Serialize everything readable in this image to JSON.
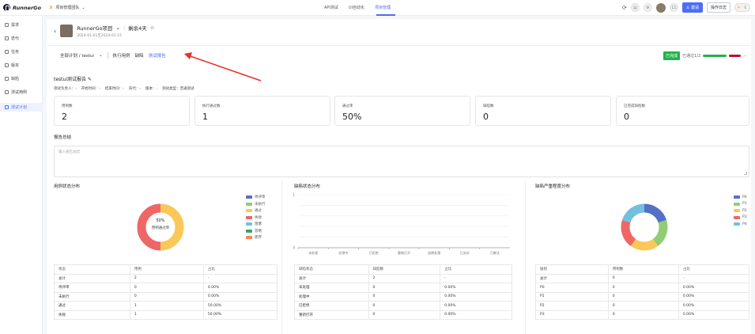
{
  "app": {
    "logo": "RunnerGo",
    "team": "项目管理团队"
  },
  "nav": {
    "items": [
      "API测试",
      "UI自动化",
      "项目管理"
    ],
    "active": 2
  },
  "topright": {
    "avatar_initial": "11",
    "invite": "邀请",
    "log": "操作日志"
  },
  "sidebar": {
    "items": [
      "需求",
      "迭代",
      "任务",
      "版本",
      "缺陷",
      "测试用例",
      "测试计划"
    ],
    "active": 6
  },
  "header": {
    "project": "RunnerGo项目",
    "remaining": "剩余4天",
    "date_range": "2024-01-01至2024-01-15"
  },
  "tabs": {
    "plan": "全部计划 / testui",
    "items": [
      "执行用例",
      "缺陷",
      "测试报告"
    ],
    "active": 2
  },
  "status": {
    "done": "已完成",
    "passed": "已通过1/2",
    "more": "···"
  },
  "report": {
    "title": "testui测试报告",
    "meta": [
      "测试负责人：-",
      "开始时间：-",
      "结束时间：-",
      "迭代：-",
      "版本：-",
      "测试类型：普通测试"
    ]
  },
  "cards": [
    {
      "label": "用例数",
      "value": "2"
    },
    {
      "label": "执行通过数",
      "value": "1"
    },
    {
      "label": "通过率",
      "value": "50%"
    },
    {
      "label": "缺陷数",
      "value": "0"
    },
    {
      "label": "已完成缺陷数",
      "value": "0"
    }
  ],
  "summary": {
    "label": "报告总结",
    "placeholder": "输入报告总结"
  },
  "charts": {
    "case": {
      "title": "用例状态分布",
      "center_value": "50%",
      "center_label": "用例通过率"
    },
    "defect": {
      "title": "缺陷状态分布"
    },
    "severity": {
      "title": "缺陷严重程度分布"
    }
  },
  "chart_data": [
    {
      "type": "pie",
      "title": "用例状态分布",
      "categories": [
        "待评审",
        "未执行",
        "通过",
        "失败",
        "阻塞",
        "忽略",
        "废弃"
      ],
      "values": [
        0,
        0,
        1,
        1,
        0,
        0,
        0
      ],
      "colors": [
        "#5470c6",
        "#91cc75",
        "#fac858",
        "#ee6666",
        "#73c0de",
        "#3ba272",
        "#fc8452"
      ],
      "legend": "right"
    },
    {
      "type": "bar",
      "title": "缺陷状态分布",
      "categories": [
        "未处理",
        "处理中",
        "已拒绝",
        "重新打开",
        "延期处理",
        "已关闭",
        "已解决"
      ],
      "values": [
        0,
        0,
        0,
        0,
        0,
        0,
        0
      ],
      "y_ticks": [
        "0",
        "1"
      ],
      "grid": true
    },
    {
      "type": "pie",
      "title": "缺陷严重程度分布",
      "categories": [
        "P0",
        "P1",
        "P2",
        "P3",
        "P4"
      ],
      "values": [
        1,
        1,
        1,
        1,
        1
      ],
      "colors": [
        "#5470c6",
        "#91cc75",
        "#fac858",
        "#ee6666",
        "#73c0de"
      ],
      "legend": "right"
    }
  ],
  "tables": {
    "case": {
      "headers": [
        "状态",
        "用例",
        "占比"
      ],
      "rows": [
        [
          "总计",
          "2",
          "-"
        ],
        [
          "待评审",
          "0",
          "0.00%"
        ],
        [
          "未执行",
          "0",
          "0.00%"
        ],
        [
          "通过",
          "1",
          "50.00%"
        ],
        [
          "失败",
          "1",
          "50.00%"
        ]
      ]
    },
    "defect": {
      "headers": [
        "缺陷状态",
        "缺陷数",
        "占比"
      ],
      "rows": [
        [
          "总计",
          "2",
          "-"
        ],
        [
          "未处理",
          "0",
          "0.00%"
        ],
        [
          "处理中",
          "0",
          "0.00%"
        ],
        [
          "已拒绝",
          "0",
          "0.00%"
        ],
        [
          "重新打开",
          "0",
          "0.00%"
        ]
      ]
    },
    "severity": {
      "headers": [
        "级别",
        "用例数",
        "占比"
      ],
      "rows": [
        [
          "总计",
          "0",
          "-"
        ],
        [
          "P0",
          "0",
          "0.00%"
        ],
        [
          "P1",
          "0",
          "0.00%"
        ],
        [
          "P2",
          "0",
          "0.00%"
        ],
        [
          "P3",
          "0",
          "0.00%"
        ]
      ]
    }
  }
}
